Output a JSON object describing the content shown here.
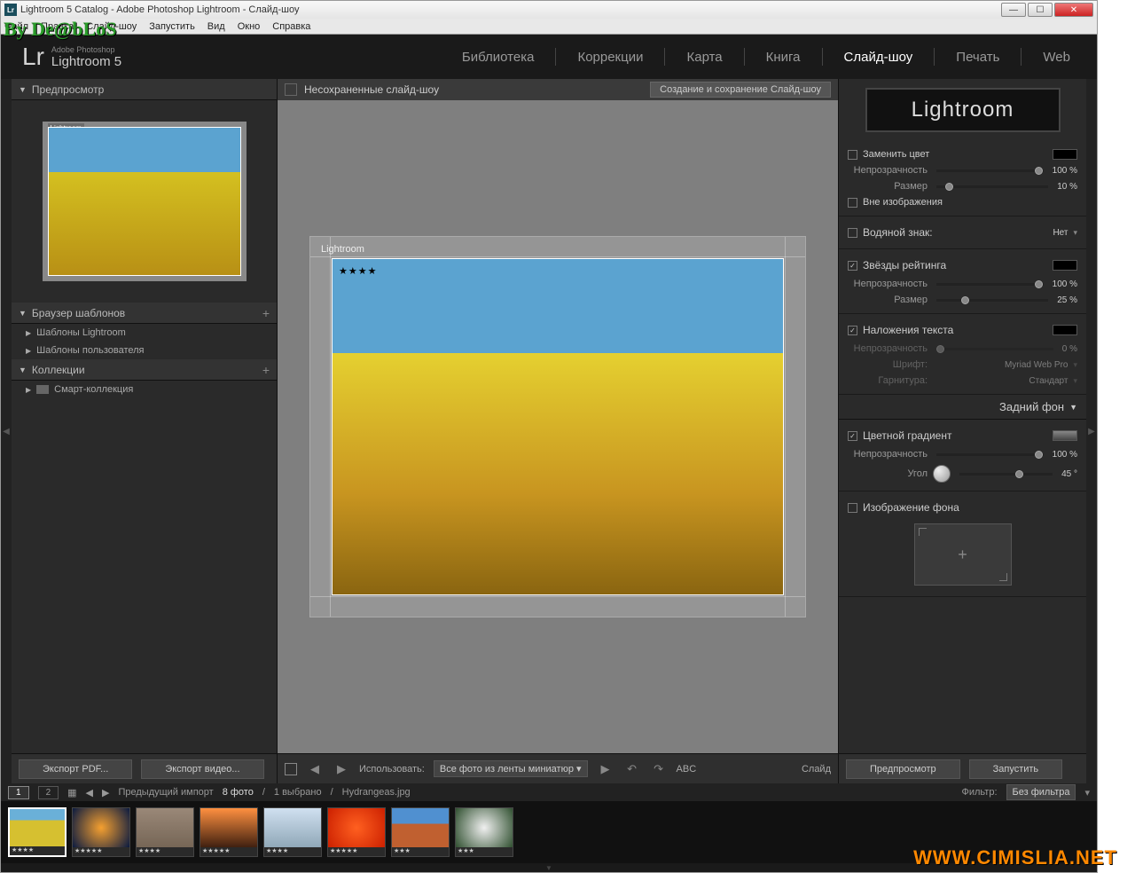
{
  "overlay": {
    "by": "By De@bLoS",
    "url": "WWW.CIMISLIA.NET"
  },
  "titlebar": {
    "text": "Lightroom 5 Catalog - Adobe Photoshop Lightroom - Слайд-шоу",
    "icon": "Lr"
  },
  "menubar": [
    "Файл",
    "Правка",
    "Слайд-шоу",
    "Запустить",
    "Вид",
    "Окно",
    "Справка"
  ],
  "logo": {
    "big": "Lr",
    "small": "Adobe Photoshop",
    "med": "Lightroom 5"
  },
  "modules": [
    "Библиотека",
    "Коррекции",
    "Карта",
    "Книга",
    "Слайд-шоу",
    "Печать",
    "Web"
  ],
  "active_module": "Слайд-шоу",
  "left": {
    "preview": "Предпросмотр",
    "preview_tag": "Lightroom",
    "browser": "Браузер шаблонов",
    "templates": [
      "Шаблоны Lightroom",
      "Шаблоны пользователя"
    ],
    "collections": "Коллекции",
    "smart": "Смарт-коллекция"
  },
  "center": {
    "title": "Несохраненные слайд-шоу",
    "save_btn": "Создание и сохранение Слайд-шоу",
    "tag": "Lightroom",
    "stars": "★★★★"
  },
  "toolbar": {
    "export_pdf": "Экспорт PDF...",
    "export_video": "Экспорт видео...",
    "use_label": "Использовать:",
    "use_value": "Все фото из ленты миниатюр",
    "abc": "ABC",
    "slide_label": "Слайд",
    "preview_btn": "Предпросмотр",
    "play_btn": "Запустить"
  },
  "right": {
    "identity": "Lightroom",
    "replace_color": "Заменить цвет",
    "opacity": "Непрозрачность",
    "size": "Размер",
    "outside_image": "Вне изображения",
    "watermark": "Водяной знак:",
    "watermark_val": "Нет",
    "rating_stars": "Звёзды рейтинга",
    "text_overlays": "Наложения текста",
    "font": "Шрифт:",
    "font_val": "Myriad Web Pro",
    "face": "Гарнитура:",
    "face_val": "Стандарт",
    "backdrop": "Задний фон",
    "color_wash": "Цветной градиент",
    "angle": "Угол",
    "bg_image": "Изображение фона",
    "vals": {
      "opacity1": "100 %",
      "size1": "10 %",
      "opacity2": "100 %",
      "size2": "25 %",
      "opacity3": "0 %",
      "opacity4": "100 %",
      "angle": "45 °"
    }
  },
  "filmstrip": {
    "prev_import": "Предыдущий импорт",
    "count": "8 фото",
    "selected": "1 выбрано",
    "filename": "Hydrangeas.jpg",
    "filter_label": "Фильтр:",
    "filter_val": "Без фильтра",
    "thumbs": [
      {
        "stars": "★★★★",
        "bg": "linear-gradient(#6ab0d8 30%,#d6c030 30%)"
      },
      {
        "stars": "★★★★★",
        "bg": "radial-gradient(circle,#f5a030,#0a1a40)"
      },
      {
        "stars": "★★★★",
        "bg": "linear-gradient(#9a8878,#766656)"
      },
      {
        "stars": "★★★★★",
        "bg": "linear-gradient(#ff9040,#402010)"
      },
      {
        "stars": "★★★★",
        "bg": "linear-gradient(#d0e0f0,#90a8b8)"
      },
      {
        "stars": "★★★★★",
        "bg": "radial-gradient(circle,#ff6020,#cc2000)"
      },
      {
        "stars": "★★★",
        "bg": "linear-gradient(#5090d0 40%,#c06030 40%)"
      },
      {
        "stars": "★★★",
        "bg": "radial-gradient(circle,#f0f0f0,#305030)"
      }
    ]
  }
}
